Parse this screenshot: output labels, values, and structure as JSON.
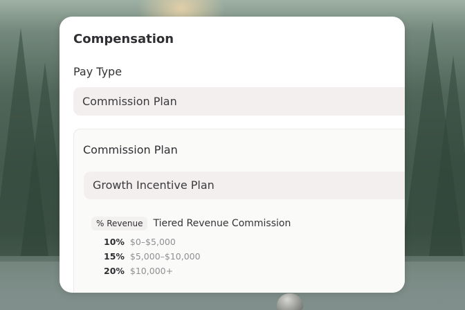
{
  "compensation": {
    "title": "Compensation",
    "pay_type_label": "Pay Type",
    "pay_type_value": "Commission Plan"
  },
  "commission_plan": {
    "title": "Commission Plan",
    "selected_plan": "Growth Incentive Plan",
    "badge": "% Revenue",
    "plan_name": "Tiered Revenue Commission",
    "tiers": [
      {
        "rate": "10%",
        "range": "$0–$5,000"
      },
      {
        "rate": "15%",
        "range": "$5,000–$10,000"
      },
      {
        "rate": "20%",
        "range": "$10,000+"
      }
    ]
  }
}
